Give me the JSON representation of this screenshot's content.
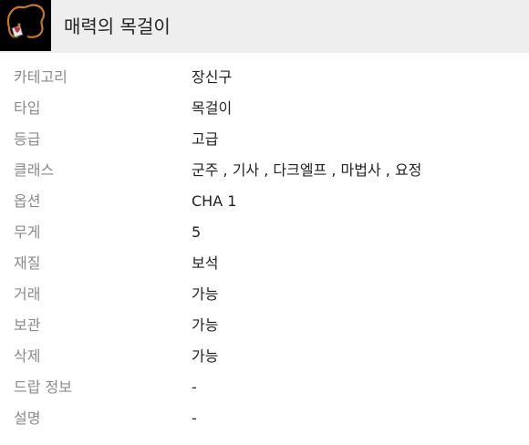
{
  "item": {
    "name": "매력의 목걸이",
    "icon": "necklace-icon"
  },
  "colors": {
    "header_bg": "#eeeeee",
    "label_text": "#8a8a8a",
    "value_text": "#222222",
    "icon_bg": "#000000",
    "chain": "#c8781e",
    "pendant": "#c0303a"
  },
  "properties": [
    {
      "label": "카테고리",
      "value": "장신구"
    },
    {
      "label": "타입",
      "value": "목걸이"
    },
    {
      "label": "등급",
      "value": "고급"
    },
    {
      "label": "클래스",
      "value": "군주 , 기사 , 다크엘프 , 마법사 , 요정"
    },
    {
      "label": "옵션",
      "value": "CHA 1"
    },
    {
      "label": "무게",
      "value": "5"
    },
    {
      "label": "재질",
      "value": "보석"
    },
    {
      "label": "거래",
      "value": "가능"
    },
    {
      "label": "보관",
      "value": "가능"
    },
    {
      "label": "삭제",
      "value": "가능"
    },
    {
      "label": "드랍 정보",
      "value": "-"
    },
    {
      "label": "설명",
      "value": "-"
    }
  ]
}
